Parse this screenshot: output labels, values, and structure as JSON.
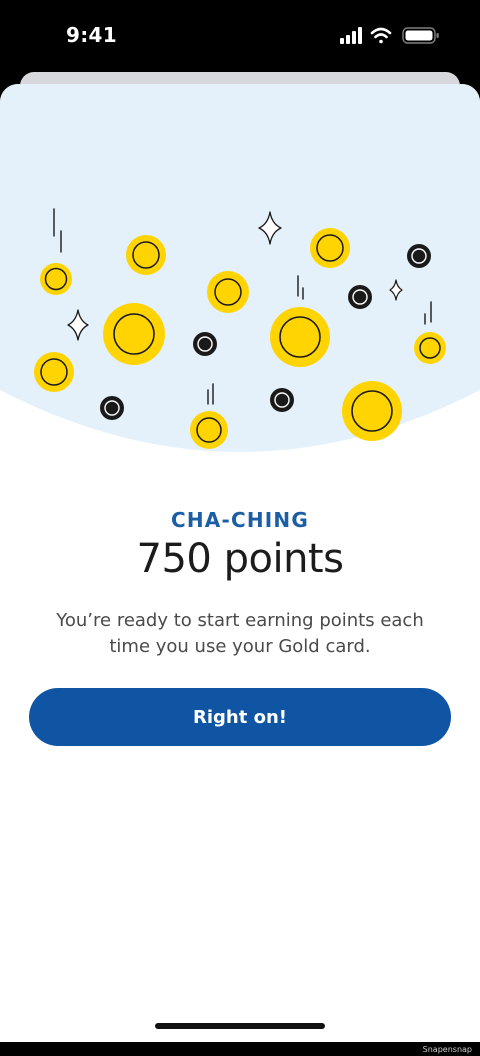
{
  "status_bar": {
    "time": "9:41",
    "icons": [
      "signal-icon",
      "wifi-icon",
      "battery-icon"
    ]
  },
  "content": {
    "eyebrow": "CHA-CHING",
    "headline": "750 points",
    "body": "You’re ready to start earning points each time you use your Gold card.",
    "button_label": "Right on!"
  },
  "watermark": "Snapensnap",
  "colors": {
    "accent": "#0f55a4",
    "eyebrow": "#1b5ea6",
    "illustration_bg": "#e4f1fa",
    "coin": "#ffd400"
  }
}
